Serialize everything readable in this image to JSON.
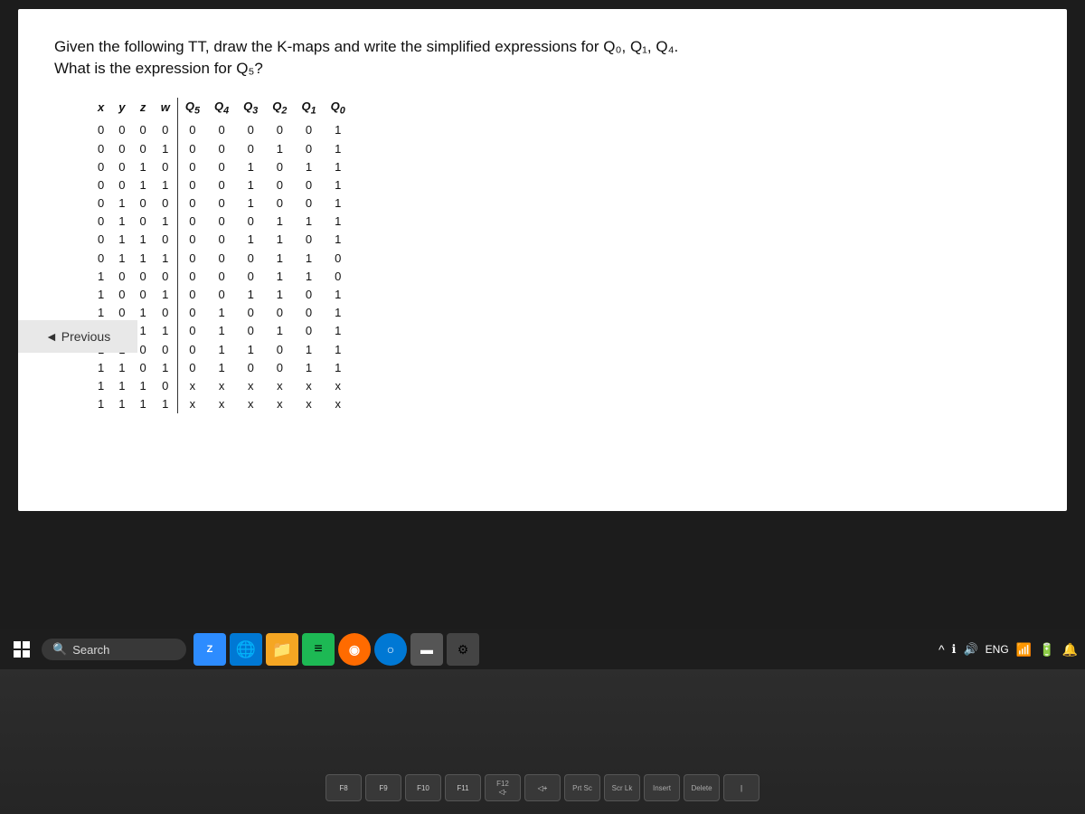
{
  "question": {
    "line1": "Given the following TT, draw the K-maps and write the simplified  expressions for Q₀, Q₁, Q₄.",
    "line2": "What is the expression for Q₅?"
  },
  "table": {
    "headers_left": [
      "x",
      "y",
      "z",
      "w"
    ],
    "headers_right": [
      "Q₅",
      "Q₄",
      "Q₃",
      "Q₂",
      "Q₁",
      "Q₀"
    ],
    "rows": [
      {
        "left": [
          "0",
          "0",
          "0",
          "0"
        ],
        "right": [
          "0",
          "0",
          "0",
          "0",
          "0",
          "1"
        ]
      },
      {
        "left": [
          "0",
          "0",
          "0",
          "1"
        ],
        "right": [
          "0",
          "0",
          "0",
          "1",
          "0",
          "1"
        ]
      },
      {
        "left": [
          "0",
          "0",
          "1",
          "0"
        ],
        "right": [
          "0",
          "0",
          "1",
          "0",
          "1",
          "1"
        ]
      },
      {
        "left": [
          "0",
          "0",
          "1",
          "1"
        ],
        "right": [
          "0",
          "0",
          "1",
          "0",
          "0",
          "1"
        ]
      },
      {
        "left": [
          "0",
          "1",
          "0",
          "0"
        ],
        "right": [
          "0",
          "0",
          "1",
          "0",
          "0",
          "1"
        ]
      },
      {
        "left": [
          "0",
          "1",
          "0",
          "1"
        ],
        "right": [
          "0",
          "0",
          "0",
          "1",
          "1",
          "1"
        ]
      },
      {
        "left": [
          "0",
          "1",
          "1",
          "0"
        ],
        "right": [
          "0",
          "0",
          "1",
          "1",
          "0",
          "1"
        ]
      },
      {
        "left": [
          "0",
          "1",
          "1",
          "1"
        ],
        "right": [
          "0",
          "0",
          "0",
          "1",
          "1",
          "0"
        ]
      },
      {
        "left": [
          "1",
          "0",
          "0",
          "0"
        ],
        "right": [
          "0",
          "0",
          "0",
          "1",
          "1",
          "0"
        ]
      },
      {
        "left": [
          "1",
          "0",
          "0",
          "1"
        ],
        "right": [
          "0",
          "0",
          "1",
          "1",
          "0",
          "1"
        ]
      },
      {
        "left": [
          "1",
          "0",
          "1",
          "0"
        ],
        "right": [
          "0",
          "1",
          "0",
          "0",
          "0",
          "1"
        ]
      },
      {
        "left": [
          "1",
          "0",
          "1",
          "1"
        ],
        "right": [
          "0",
          "1",
          "0",
          "1",
          "0",
          "1"
        ]
      },
      {
        "left": [
          "1",
          "1",
          "0",
          "0"
        ],
        "right": [
          "0",
          "1",
          "1",
          "0",
          "1",
          "1"
        ]
      },
      {
        "left": [
          "1",
          "1",
          "0",
          "1"
        ],
        "right": [
          "0",
          "1",
          "0",
          "0",
          "1",
          "1"
        ]
      },
      {
        "left": [
          "1",
          "1",
          "1",
          "0"
        ],
        "right": [
          "x",
          "x",
          "x",
          "x",
          "x",
          "x"
        ]
      },
      {
        "left": [
          "1",
          "1",
          "1",
          "1"
        ],
        "right": [
          "x",
          "x",
          "x",
          "x",
          "x",
          "x"
        ]
      }
    ]
  },
  "buttons": {
    "previous": "◄ Previous"
  },
  "taskbar": {
    "search_placeholder": "Search",
    "system_tray": {
      "lang": "ENG"
    }
  },
  "keyboard": {
    "bottom_row_keys": [
      {
        "top": "Prt Sc",
        "bottom": ""
      },
      {
        "top": "Scr Lk",
        "bottom": ""
      },
      {
        "top": "Insert",
        "bottom": ""
      },
      {
        "top": "Delete",
        "bottom": ""
      }
    ],
    "fn_row": [
      {
        "label": "F8"
      },
      {
        "label": "F9"
      },
      {
        "label": "F10"
      },
      {
        "label": "F11"
      },
      {
        "label": "F12",
        "sub": "◁-"
      },
      {
        "label": "◁+"
      }
    ]
  }
}
